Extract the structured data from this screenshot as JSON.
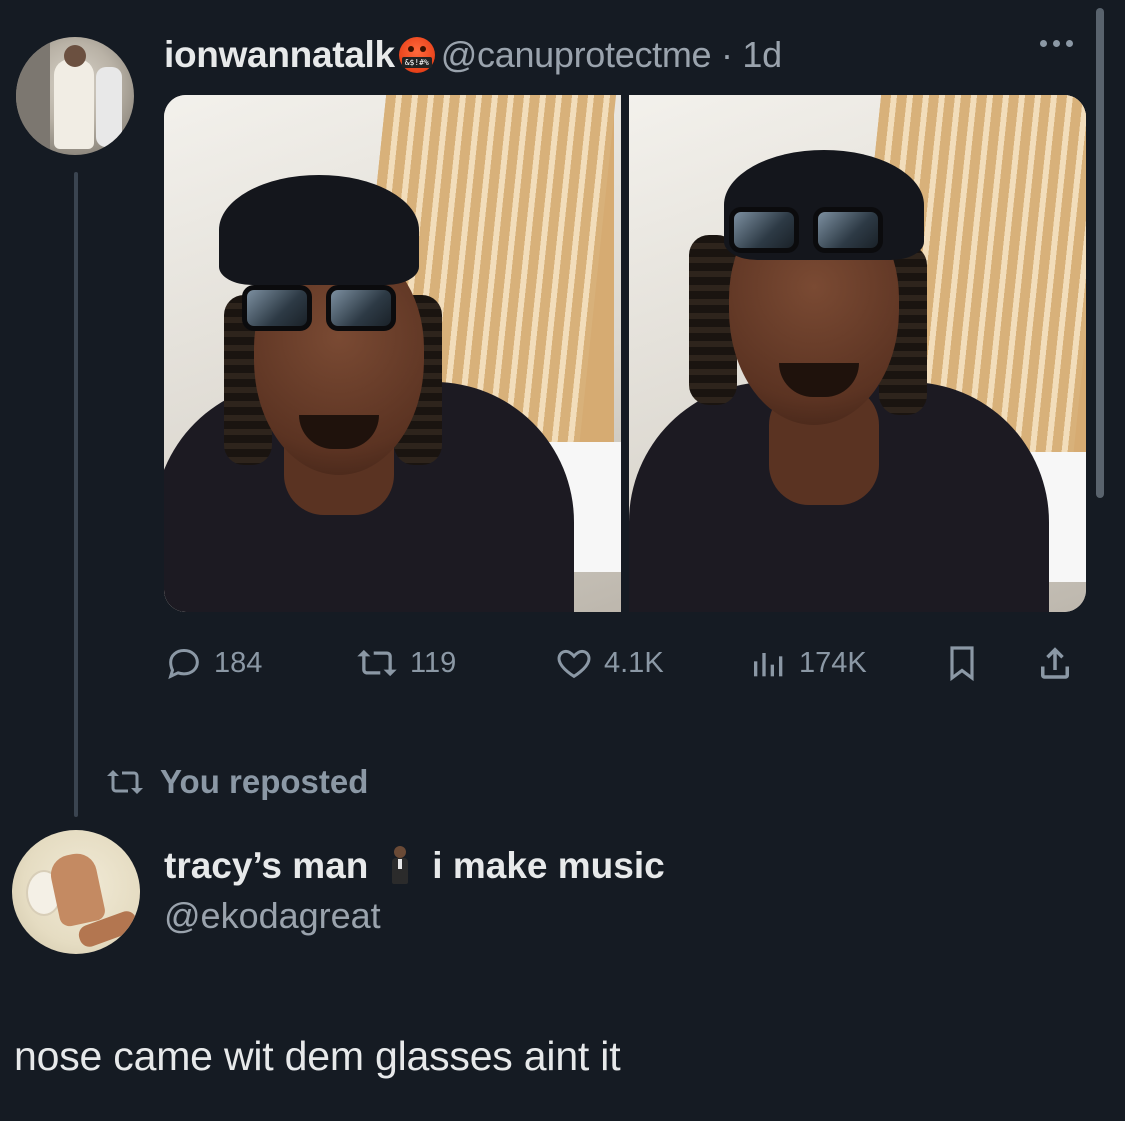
{
  "original_tweet": {
    "display_name": "ionwannatalk",
    "emoji_badge": "&$!#%",
    "handle_time": "@canuprotectme · 1d",
    "stats": {
      "replies": "184",
      "reposts": "119",
      "likes": "4.1K",
      "views": "174K"
    },
    "icons": [
      "reply-icon",
      "repost-icon",
      "like-icon",
      "views-icon",
      "bookmark-icon",
      "share-icon",
      "more-icon"
    ]
  },
  "repost_banner": {
    "label": "You reposted"
  },
  "reply_tweet": {
    "display_name_part1": "tracy’s man",
    "display_name_part2": "i make music",
    "handle": "@ekodagreat",
    "text": "nose came wit dem glasses aint it"
  },
  "colors": {
    "background": "#151b23",
    "secondary_text": "#8b98a5",
    "primary_text": "#e7e9ea"
  }
}
